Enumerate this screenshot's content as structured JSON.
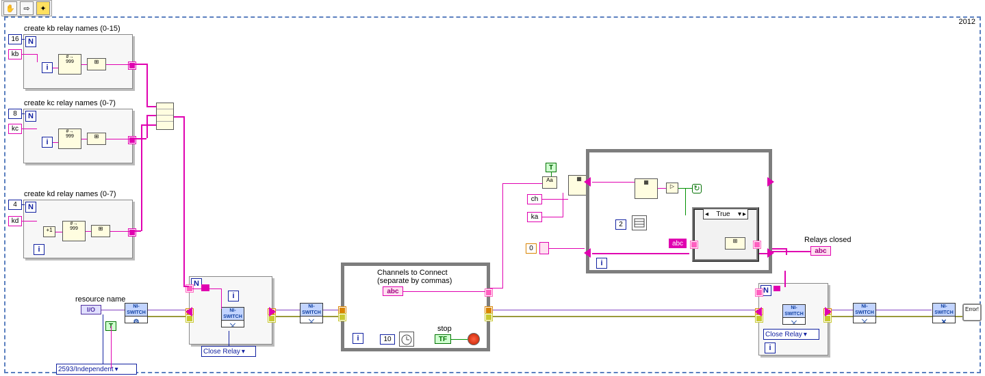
{
  "toolbar": {
    "icons": [
      "hand-icon",
      "arrow-icon",
      "highlight-exec-icon"
    ]
  },
  "seq": {
    "year": "2012"
  },
  "loops": {
    "kb": {
      "title": "create kb relay names (0-15)",
      "count": "16",
      "prefix": "kb"
    },
    "kc": {
      "title": "create kc relay names (0-7)",
      "count": "8",
      "prefix": "kc"
    },
    "kd": {
      "title": "create kd relay names (0-7)",
      "count": "4",
      "prefix": "kd"
    }
  },
  "resource": {
    "label": "resource name",
    "terminal": "I/O",
    "topology": "2593/Independent",
    "topology_bool": "T"
  },
  "inner_for": {
    "menu": "Close Relay"
  },
  "while": {
    "channels_label1": "Channels to Connect",
    "channels_label2": "(separate by commas)",
    "channels_ctrl": "abc",
    "wait_ms": "10",
    "stop_label": "stop",
    "stop_bool": "TF"
  },
  "parse": {
    "bool": "T",
    "match": "Aa",
    "ch": "ch",
    "ka": "ka",
    "init": "0"
  },
  "inner_while": {
    "case": "True",
    "two": "2"
  },
  "close2": {
    "menu": "Close Relay"
  },
  "out": {
    "label": "Relays closed",
    "ctrl": "abc"
  },
  "error": {
    "label": "Error"
  },
  "niswitch": {
    "text": "NI-SWITCH"
  }
}
